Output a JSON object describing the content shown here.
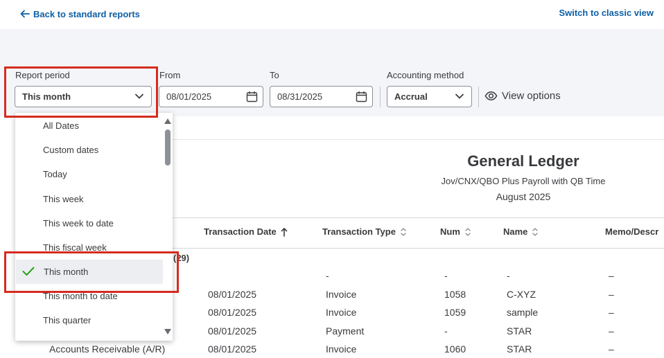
{
  "topbar": {
    "back_label": "Back to standard reports",
    "classic_label": "Switch to classic view"
  },
  "filters": {
    "report_period_label": "Report period",
    "report_period_value": "This month",
    "from_label": "From",
    "from_value": "08/01/2025",
    "to_label": "To",
    "to_value": "08/31/2025",
    "accounting_method_label": "Accounting method",
    "accounting_method_value": "Accrual",
    "view_options_label": "View options"
  },
  "dropdown": {
    "items": [
      "All Dates",
      "Custom dates",
      "Today",
      "This week",
      "This week to date",
      "This fiscal week",
      "This month",
      "This month to date",
      "This quarter"
    ],
    "selected": "This month"
  },
  "report": {
    "title": "General Ledger",
    "company": "Jov/CNX/QBO Plus Payroll with QB Time",
    "period": "August 2025",
    "columns": [
      "Transaction Date",
      "Transaction Type",
      "Num",
      "Name",
      "Memo/Descr"
    ],
    "group_label": "(29)",
    "rows": [
      {
        "account": "",
        "date": "",
        "type": "-",
        "num": "-",
        "name": "-",
        "memo": "–"
      },
      {
        "account": "",
        "date": "08/01/2025",
        "type": "Invoice",
        "num": "1058",
        "name": "C-XYZ",
        "memo": "–"
      },
      {
        "account": "",
        "date": "08/01/2025",
        "type": "Invoice",
        "num": "1059",
        "name": "sample",
        "memo": "–"
      },
      {
        "account": "",
        "date": "08/01/2025",
        "type": "Payment",
        "num": "-",
        "name": "STAR",
        "memo": "–"
      },
      {
        "account": "Accounts Receivable (A/R)",
        "date": "08/01/2025",
        "type": "Invoice",
        "num": "1060",
        "name": "STAR",
        "memo": "–"
      }
    ]
  },
  "colors": {
    "link": "#0d5fa5",
    "highlight": "#d52b1e",
    "check": "#2ca01c",
    "filter_bg": "#f4f5f8"
  }
}
